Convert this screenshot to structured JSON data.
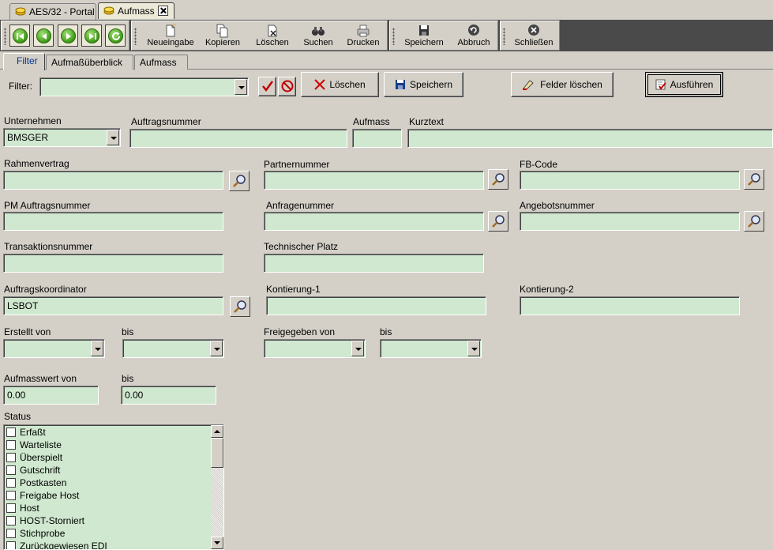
{
  "doc_tabs": [
    {
      "label": "AES/32 - Portal"
    },
    {
      "label": "Aufmass"
    }
  ],
  "toolbar": {
    "new_label": "Neueingabe",
    "copy_label": "Kopieren",
    "delete_label": "Löschen",
    "search_label": "Suchen",
    "print_label": "Drucken",
    "save_label": "Speichern",
    "cancel_label": "Abbruch",
    "close_label": "Schließen"
  },
  "sub_tabs": [
    {
      "label": "Filter"
    },
    {
      "label": "Aufmaßüberblick"
    },
    {
      "label": "Aufmass"
    }
  ],
  "filter_bar": {
    "filter_label": "Filter:",
    "filter_value": "",
    "delete_label": "Löschen",
    "save_label": "Speichern",
    "clear_fields_label": "Felder löschen",
    "execute_label": "Ausführen"
  },
  "form": {
    "unternehmen": {
      "label": "Unternehmen",
      "value": "BMSGER"
    },
    "auftragsnummer": {
      "label": "Auftragsnummer",
      "value": ""
    },
    "aufmass": {
      "label": "Aufmass",
      "value": ""
    },
    "kurztext": {
      "label": "Kurztext",
      "value": ""
    },
    "rahmenvertrag": {
      "label": "Rahmenvertrag",
      "value": ""
    },
    "partnernummer": {
      "label": "Partnernummer",
      "value": ""
    },
    "fb_code": {
      "label": "FB-Code",
      "value": ""
    },
    "pm_auftragsnummer": {
      "label": "PM Auftragsnummer",
      "value": ""
    },
    "anfragenummer": {
      "label": "Anfragenummer",
      "value": ""
    },
    "angebotsnummer": {
      "label": "Angebotsnummer",
      "value": ""
    },
    "transaktionsnummer": {
      "label": "Transaktionsnummer",
      "value": ""
    },
    "technischer_platz": {
      "label": "Technischer Platz",
      "value": ""
    },
    "auftragskoordinator": {
      "label": "Auftragskoordinator",
      "value": "LSBOT"
    },
    "kontierung_1": {
      "label": "Kontierung-1",
      "value": ""
    },
    "kontierung_2": {
      "label": "Kontierung-2",
      "value": ""
    },
    "erstellt_von": {
      "label": "Erstellt von",
      "value": ""
    },
    "erstellt_bis": {
      "label": "bis",
      "value": ""
    },
    "freigegeben_von": {
      "label": "Freigegeben von",
      "value": ""
    },
    "freigegeben_bis": {
      "label": "bis",
      "value": ""
    },
    "aufmasswert_von": {
      "label": "Aufmasswert von",
      "value": "0.00"
    },
    "aufmasswert_bis": {
      "label": "bis",
      "value": "0.00"
    }
  },
  "status": {
    "label": "Status",
    "items": [
      {
        "label": "Erfaßt"
      },
      {
        "label": "Warteliste"
      },
      {
        "label": "Überspielt"
      },
      {
        "label": "Gutschrift"
      },
      {
        "label": "Postkasten"
      },
      {
        "label": "Freigabe Host"
      },
      {
        "label": "Host"
      },
      {
        "label": "HOST-Storniert"
      },
      {
        "label": "Stichprobe"
      },
      {
        "label": "Zurückgewiesen EDI"
      }
    ]
  }
}
